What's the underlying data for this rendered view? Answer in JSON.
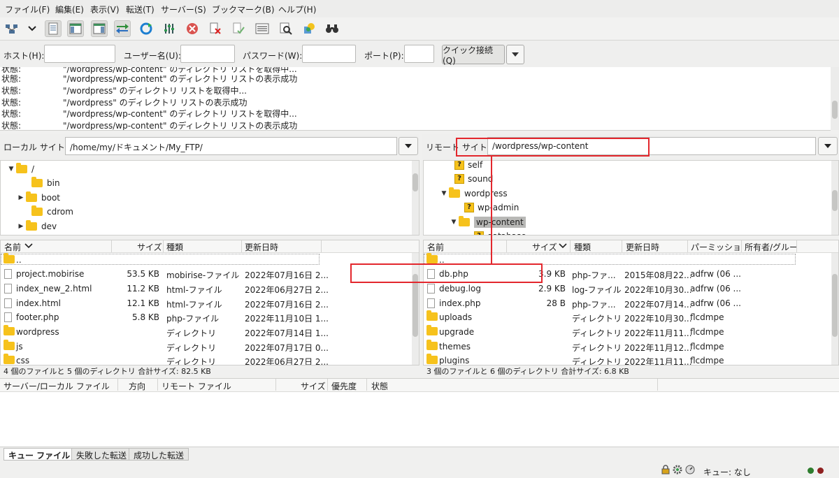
{
  "menu": [
    "ファイル(F)",
    "編集(E)",
    "表示(V)",
    "転送(T)",
    "サーバー(S)",
    "ブックマーク(B)",
    "ヘルプ(H)"
  ],
  "quickconnect": {
    "host_label": "ホスト(H):",
    "user_label": "ユーザー名(U):",
    "pass_label": "パスワード(W):",
    "port_label": "ポート(P):",
    "connect_label": "クイック接続(Q)"
  },
  "log": [
    {
      "k": "状態:",
      "m": "\"/wordpress/wp-content\" のディレクトリ リストを取得中..."
    },
    {
      "k": "状態:",
      "m": "\"/wordpress/wp-content\" のディレクトリ リストの表示成功"
    },
    {
      "k": "状態:",
      "m": "\"/wordpress\" のディレクトリ リストを取得中..."
    },
    {
      "k": "状態:",
      "m": "\"/wordpress\" のディレクトリ リストの表示成功"
    },
    {
      "k": "状態:",
      "m": "\"/wordpress/wp-content\" のディレクトリ リストを取得中..."
    },
    {
      "k": "状態:",
      "m": "\"/wordpress/wp-content\" のディレクトリ リストの表示成功"
    }
  ],
  "local": {
    "site_label": "ローカル サイト:",
    "path": "/home/my/ドキュメント/My_FTP/",
    "tree": [
      "/",
      "bin",
      "boot",
      "cdrom",
      "dev"
    ],
    "headers": [
      "名前",
      "サイズ",
      "種類",
      "更新日時"
    ],
    "files": [
      {
        "name": "..",
        "size": "",
        "type": "",
        "date": ""
      },
      {
        "name": "project.mobirise",
        "size": "53.5 KB",
        "type": "mobirise-ファイル",
        "date": "2022年07月16日 2..."
      },
      {
        "name": "index_new_2.html",
        "size": "11.2 KB",
        "type": "html-ファイル",
        "date": "2022年06月27日 2..."
      },
      {
        "name": "index.html",
        "size": "12.1 KB",
        "type": "html-ファイル",
        "date": "2022年07月16日 2..."
      },
      {
        "name": "footer.php",
        "size": "5.8 KB",
        "type": "php-ファイル",
        "date": "2022年11月10日 1..."
      },
      {
        "name": "wordpress",
        "size": "",
        "type": "ディレクトリ",
        "date": "2022年07月14日 1..."
      },
      {
        "name": "js",
        "size": "",
        "type": "ディレクトリ",
        "date": "2022年07月17日 0..."
      },
      {
        "name": "css",
        "size": "",
        "type": "ディレクトリ",
        "date": "2022年06月27日 2..."
      }
    ],
    "status": "4 個のファイルと 5 個のディレクトリ 合計サイズ: 82.5 KB"
  },
  "remote": {
    "site_label": "リモート サイト:",
    "path": "/wordpress/wp-content",
    "tree": [
      "self",
      "sound",
      "wordpress",
      "wp-admin",
      "wp-content",
      "database"
    ],
    "headers": [
      "名前",
      "サイズ",
      "種類",
      "更新日時",
      "パーミッショ",
      "所有者/グルー"
    ],
    "files": [
      {
        "name": "..",
        "size": "",
        "type": "",
        "date": "",
        "perm": ""
      },
      {
        "name": "db.php",
        "size": "3.9 KB",
        "type": "php-ファ...",
        "date": "2015年08月22...",
        "perm": "adfrw (06 ..."
      },
      {
        "name": "debug.log",
        "size": "2.9 KB",
        "type": "log-ファイル",
        "date": "2022年10月30...",
        "perm": "adfrw (06 ..."
      },
      {
        "name": "index.php",
        "size": "28 B",
        "type": "php-ファ...",
        "date": "2022年07月14...",
        "perm": "adfrw (06 ..."
      },
      {
        "name": "uploads",
        "size": "",
        "type": "ディレクトリ",
        "date": "2022年10月30...",
        "perm": "flcdmpe"
      },
      {
        "name": "upgrade",
        "size": "",
        "type": "ディレクトリ",
        "date": "2022年11月11...",
        "perm": "flcdmpe"
      },
      {
        "name": "themes",
        "size": "",
        "type": "ディレクトリ",
        "date": "2022年11月12...",
        "perm": "flcdmpe"
      },
      {
        "name": "plugins",
        "size": "",
        "type": "ディレクトリ",
        "date": "2022年11月11...",
        "perm": "flcdmpe"
      }
    ],
    "status": "3 個のファイルと 6 個のディレクトリ 合計サイズ: 6.8 KB"
  },
  "queue_headers": [
    "サーバー/ローカル ファイル",
    "方向",
    "リモート ファイル",
    "サイズ",
    "優先度",
    "状態"
  ],
  "tabs": [
    "キュー ファイル",
    "失敗した転送",
    "成功した転送"
  ],
  "queue_status": "キュー: なし",
  "colors": {
    "annotation": "#e3272d",
    "folder": "#f6c21c",
    "selection": "#b8b8b6"
  }
}
